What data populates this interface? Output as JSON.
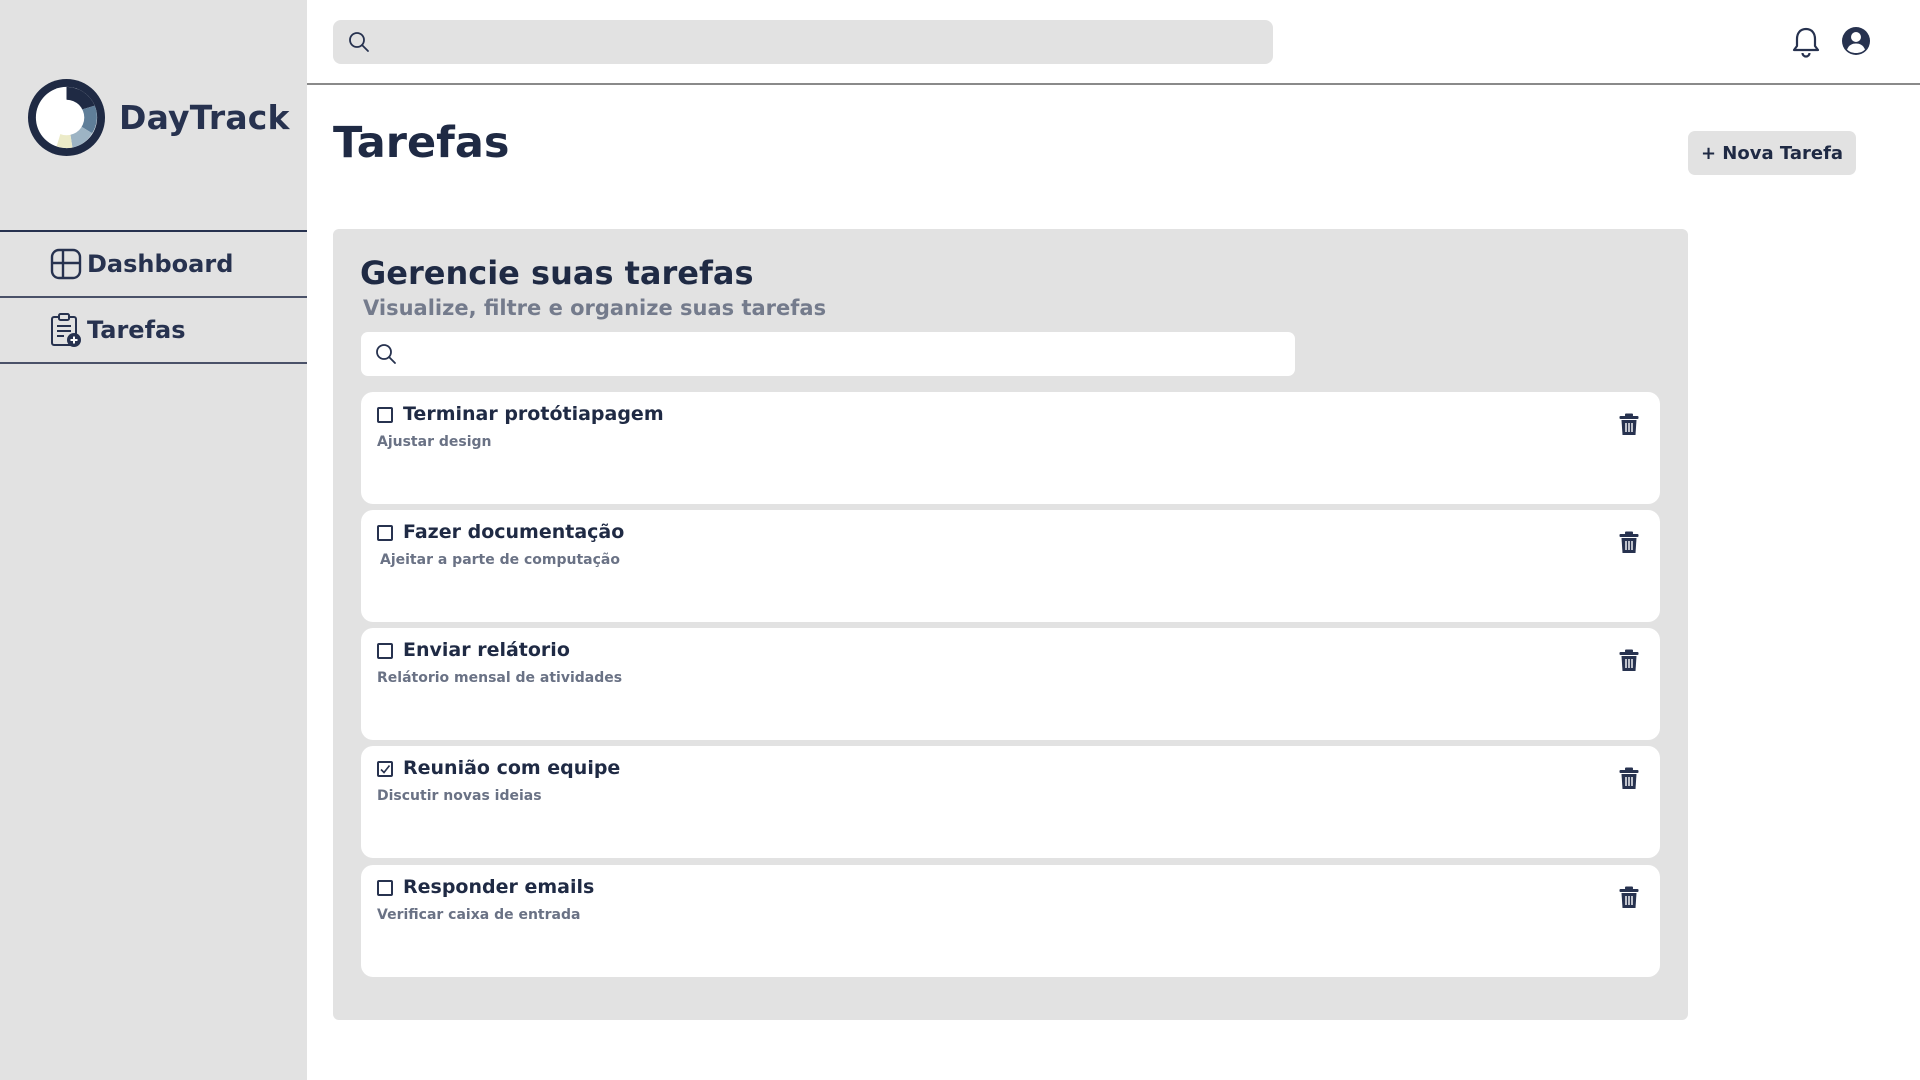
{
  "app": {
    "name": "DayTrack"
  },
  "sidebar": {
    "items": [
      {
        "label": "Dashboard",
        "icon": "dashboard-icon"
      },
      {
        "label": "Tarefas",
        "icon": "clipboard-add-icon"
      }
    ]
  },
  "topbar": {
    "search": {
      "placeholder": "",
      "value": ""
    },
    "icons": [
      "search-icon",
      "bell-icon",
      "user-icon"
    ]
  },
  "page": {
    "title": "Tarefas",
    "new_task_label": "+ Nova Tarefa"
  },
  "panel": {
    "title": "Gerencie suas tarefas",
    "subtitle": "Visualize, filtre e organize suas tarefas",
    "search": {
      "placeholder": "",
      "value": ""
    }
  },
  "tasks": [
    {
      "title": "Terminar protótiapagem",
      "description": "Ajustar design",
      "checked": false
    },
    {
      "title": "Fazer documentação",
      "description": "Ajeitar a parte de computação",
      "checked": false
    },
    {
      "title": "Enviar relátorio",
      "description": "Relátorio mensal de atividades",
      "checked": false
    },
    {
      "title": "Reunião com equipe",
      "description": "Discutir novas ideias",
      "checked": true
    },
    {
      "title": "Responder emails",
      "description": "Verificar caixa de entrada",
      "checked": false
    }
  ],
  "colors": {
    "navy": "#1f2a44",
    "gray_bg": "#e2e2e2",
    "muted_text": "#747b8c",
    "logo_light_blue": "#9db4c4",
    "logo_steel": "#5f7e99",
    "logo_cream": "#ecebc8"
  }
}
